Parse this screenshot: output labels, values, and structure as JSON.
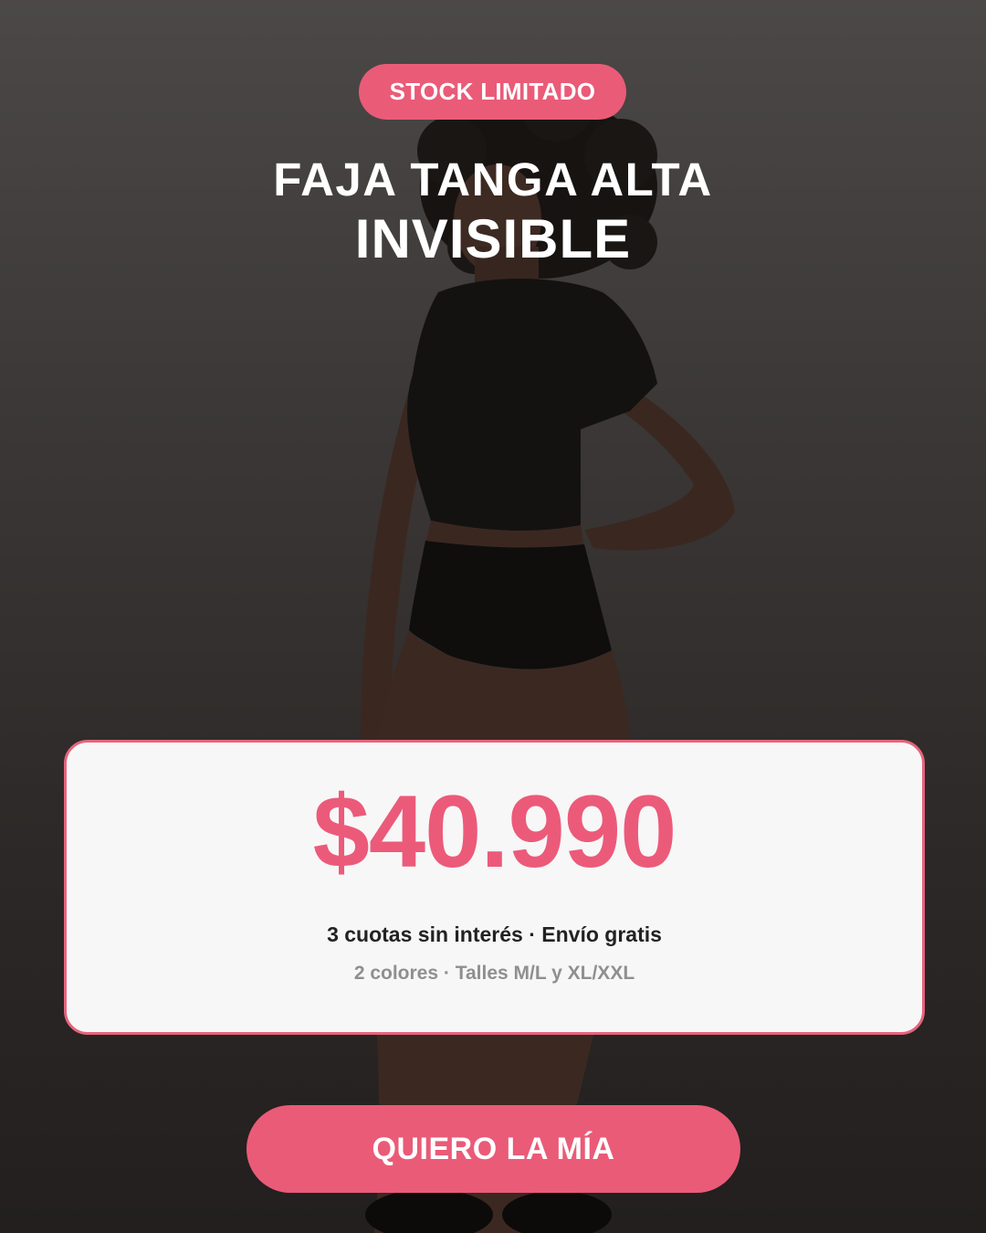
{
  "badge": {
    "label": "STOCK LIMITADO"
  },
  "headline": {
    "line1": "FAJA TANGA ALTA",
    "line2": "INVISIBLE"
  },
  "price_card": {
    "price": "$40.990",
    "terms": "3 cuotas sin interés · Envío gratis",
    "details": "2 colores · Talles M/L y XL/XXL"
  },
  "cta": {
    "label": "QUIERO LA MÍA"
  },
  "colors": {
    "accent": "#EA5B78",
    "price_text": "#EC5A7A",
    "background_top": "#4B4847",
    "background_bottom": "#221F1E",
    "card_background": "#F7F7F7"
  }
}
